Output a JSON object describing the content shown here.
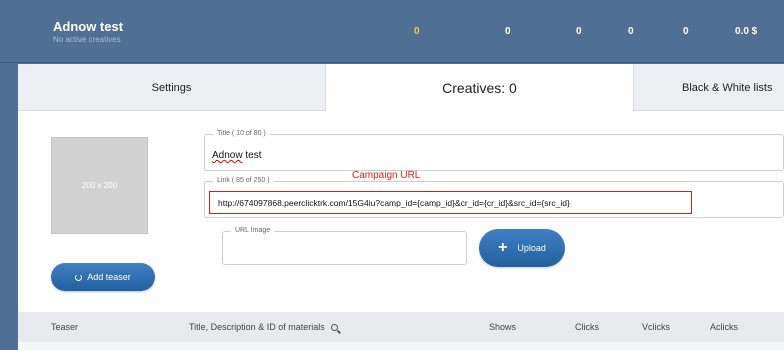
{
  "header": {
    "campaign_name": "Adnow test",
    "campaign_status": "No active creatives",
    "stats": [
      "0",
      "0",
      "0",
      "0",
      "0",
      "0.0 $"
    ],
    "highlight_color": "#f2c94c"
  },
  "tabs": {
    "settings": "Settings",
    "creatives": "Creatives: 0",
    "bw_lists": "Black & White lists"
  },
  "thumbnail": {
    "placeholder": "200 x 200"
  },
  "form": {
    "title_legend": "Title ( 10 of 80 )",
    "title_value_first": "Adnow",
    "title_value_rest": " test",
    "link_legend": "Link ( 85 of 250 )",
    "link_value": "http://674097868.peerclicktrk.com/15G4iu?camp_id={camp_id}&cr_id={cr_id}&src_id={src_id}",
    "annotation": "Campaign URL",
    "url_image_legend": "URL Image",
    "upload_label": "Upload"
  },
  "buttons": {
    "add_teaser": "Add teaser"
  },
  "table": {
    "columns": {
      "teaser": "Teaser",
      "title_desc": "Title, Description & ID of materials",
      "shows": "Shows",
      "clicks": "Clicks",
      "vclicks": "Vclicks",
      "aclicks": "Aclicks"
    }
  }
}
